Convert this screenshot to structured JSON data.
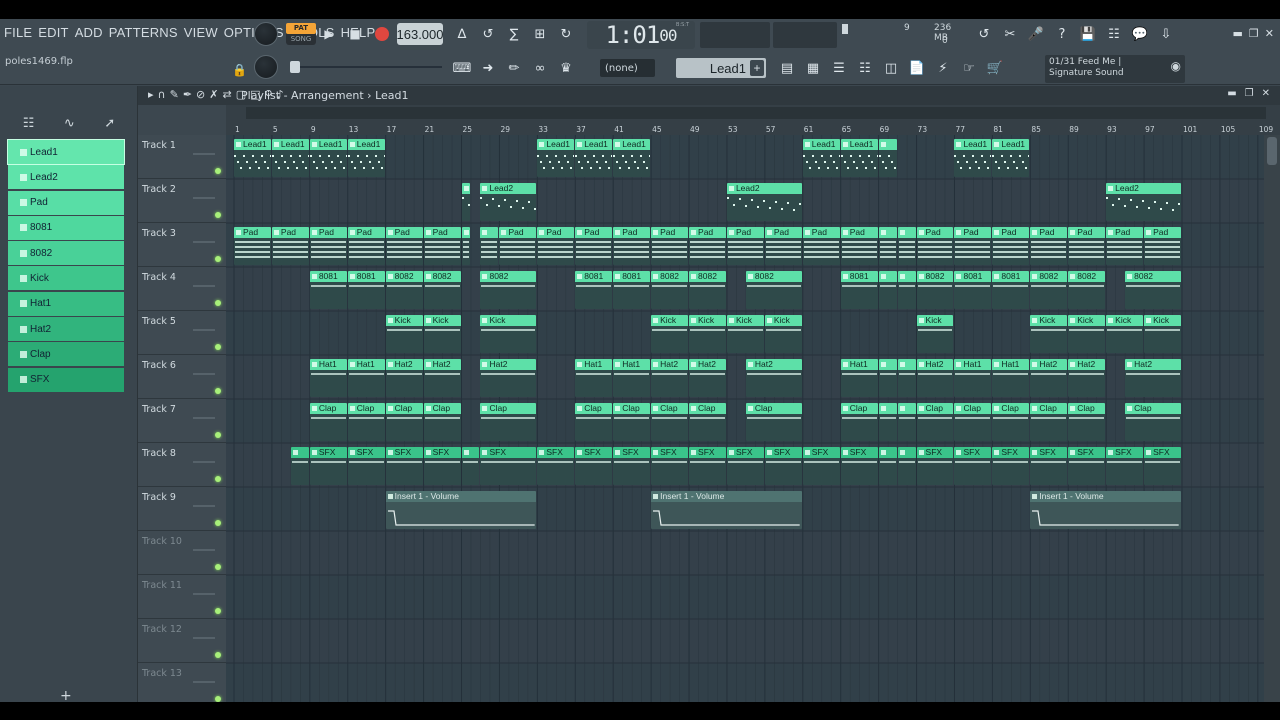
{
  "menu": [
    "FILE",
    "EDIT",
    "ADD",
    "PATTERNS",
    "VIEW",
    "OPTIONS",
    "TOOLS",
    "HELP"
  ],
  "file_name": "poles1469.flp",
  "transport": {
    "pat": "PAT",
    "song": "SONG",
    "tempo": "163.000",
    "time_main": "1:01",
    "time_sub": "00",
    "bst": "B:S:T"
  },
  "meter": {
    "cpu": "9",
    "mem": "236 MB",
    "poly": "0"
  },
  "pattern_selector": {
    "none": "(none)",
    "current": "Lead1",
    "plus": "+"
  },
  "song_info": {
    "line1": "01/31  Feed Me |",
    "line2": "Signature Sound"
  },
  "playlist": {
    "title": "Playlist - Arrangement",
    "breadcrumb_sep": "›",
    "pattern": "Lead1"
  },
  "picker": {
    "items": [
      "Lead1",
      "Lead2",
      "Pad",
      "8081",
      "8082",
      "Kick",
      "Hat1",
      "Hat2",
      "Clap",
      "SFX"
    ],
    "plus": "+"
  },
  "tracks": [
    "Track 1",
    "Track 2",
    "Track 3",
    "Track 4",
    "Track 5",
    "Track 6",
    "Track 7",
    "Track 8",
    "Track 9",
    "Track 10",
    "Track 11",
    "Track 12",
    "Track 13"
  ],
  "ruler": [
    "1",
    "5",
    "9",
    "13",
    "17",
    "21",
    "25",
    "29",
    "33",
    "37",
    "41",
    "45",
    "49",
    "53",
    "57",
    "61",
    "65",
    "69",
    "73",
    "77",
    "81",
    "85",
    "89",
    "93",
    "97",
    "101",
    "105",
    "109"
  ],
  "colors": {
    "clip": "#5de0a8",
    "clip_dark": "#3ac48a",
    "grid": "#2f3b42",
    "auto": "#4a6a66"
  },
  "clips": [
    {
      "t": 0,
      "bar": 1,
      "len": 4,
      "name": "Lead1"
    },
    {
      "t": 0,
      "bar": 5,
      "len": 4,
      "name": "Lead1"
    },
    {
      "t": 0,
      "bar": 9,
      "len": 4,
      "name": "Lead1"
    },
    {
      "t": 0,
      "bar": 13,
      "len": 4,
      "name": "Lead1"
    },
    {
      "t": 0,
      "bar": 33,
      "len": 4,
      "name": "Lead1"
    },
    {
      "t": 0,
      "bar": 37,
      "len": 4,
      "name": "Lead1"
    },
    {
      "t": 0,
      "bar": 41,
      "len": 4,
      "name": "Lead1"
    },
    {
      "t": 0,
      "bar": 61,
      "len": 4,
      "name": "Lead1"
    },
    {
      "t": 0,
      "bar": 65,
      "len": 4,
      "name": "Lead1"
    },
    {
      "t": 0,
      "bar": 69,
      "len": 2,
      "name": ""
    },
    {
      "t": 0,
      "bar": 77,
      "len": 4,
      "name": "Lead1"
    },
    {
      "t": 0,
      "bar": 81,
      "len": 4,
      "name": "Lead1"
    },
    {
      "t": 1,
      "bar": 25,
      "len": 1,
      "name": ""
    },
    {
      "t": 1,
      "bar": 27,
      "len": 6,
      "name": "Lead2"
    },
    {
      "t": 1,
      "bar": 53,
      "len": 8,
      "name": "Lead2"
    },
    {
      "t": 1,
      "bar": 93,
      "len": 8,
      "name": "Lead2"
    },
    {
      "t": 2,
      "bar": 1,
      "len": 4,
      "name": "Pad"
    },
    {
      "t": 2,
      "bar": 5,
      "len": 4,
      "name": "Pad"
    },
    {
      "t": 2,
      "bar": 9,
      "len": 4,
      "name": "Pad"
    },
    {
      "t": 2,
      "bar": 13,
      "len": 4,
      "name": "Pad"
    },
    {
      "t": 2,
      "bar": 17,
      "len": 4,
      "name": "Pad"
    },
    {
      "t": 2,
      "bar": 21,
      "len": 4,
      "name": "Pad"
    },
    {
      "t": 2,
      "bar": 25,
      "len": 1,
      "name": ""
    },
    {
      "t": 2,
      "bar": 27,
      "len": 2,
      "name": ""
    },
    {
      "t": 2,
      "bar": 29,
      "len": 4,
      "name": "Pad"
    },
    {
      "t": 2,
      "bar": 33,
      "len": 4,
      "name": "Pad"
    },
    {
      "t": 2,
      "bar": 37,
      "len": 4,
      "name": "Pad"
    },
    {
      "t": 2,
      "bar": 41,
      "len": 4,
      "name": "Pad"
    },
    {
      "t": 2,
      "bar": 45,
      "len": 4,
      "name": "Pad"
    },
    {
      "t": 2,
      "bar": 49,
      "len": 4,
      "name": "Pad"
    },
    {
      "t": 2,
      "bar": 53,
      "len": 4,
      "name": "Pad"
    },
    {
      "t": 2,
      "bar": 57,
      "len": 4,
      "name": "Pad"
    },
    {
      "t": 2,
      "bar": 61,
      "len": 4,
      "name": "Pad"
    },
    {
      "t": 2,
      "bar": 65,
      "len": 4,
      "name": "Pad"
    },
    {
      "t": 2,
      "bar": 69,
      "len": 2,
      "name": ""
    },
    {
      "t": 2,
      "bar": 71,
      "len": 2,
      "name": ""
    },
    {
      "t": 2,
      "bar": 73,
      "len": 4,
      "name": "Pad"
    },
    {
      "t": 2,
      "bar": 77,
      "len": 4,
      "name": "Pad"
    },
    {
      "t": 2,
      "bar": 81,
      "len": 4,
      "name": "Pad"
    },
    {
      "t": 2,
      "bar": 85,
      "len": 4,
      "name": "Pad"
    },
    {
      "t": 2,
      "bar": 89,
      "len": 4,
      "name": "Pad"
    },
    {
      "t": 2,
      "bar": 93,
      "len": 4,
      "name": "Pad"
    },
    {
      "t": 2,
      "bar": 97,
      "len": 4,
      "name": "Pad"
    },
    {
      "t": 3,
      "bar": 9,
      "len": 4,
      "name": "8081"
    },
    {
      "t": 3,
      "bar": 13,
      "len": 4,
      "name": "8081"
    },
    {
      "t": 3,
      "bar": 17,
      "len": 4,
      "name": "8082"
    },
    {
      "t": 3,
      "bar": 21,
      "len": 4,
      "name": "8082"
    },
    {
      "t": 3,
      "bar": 27,
      "len": 6,
      "name": "8082"
    },
    {
      "t": 3,
      "bar": 37,
      "len": 4,
      "name": "8081"
    },
    {
      "t": 3,
      "bar": 41,
      "len": 4,
      "name": "8081"
    },
    {
      "t": 3,
      "bar": 45,
      "len": 4,
      "name": "8082"
    },
    {
      "t": 3,
      "bar": 49,
      "len": 4,
      "name": "8082"
    },
    {
      "t": 3,
      "bar": 55,
      "len": 6,
      "name": "8082"
    },
    {
      "t": 3,
      "bar": 65,
      "len": 4,
      "name": "8081"
    },
    {
      "t": 3,
      "bar": 69,
      "len": 2,
      "name": ""
    },
    {
      "t": 3,
      "bar": 71,
      "len": 2,
      "name": ""
    },
    {
      "t": 3,
      "bar": 73,
      "len": 4,
      "name": "8082"
    },
    {
      "t": 3,
      "bar": 77,
      "len": 4,
      "name": "8081"
    },
    {
      "t": 3,
      "bar": 81,
      "len": 4,
      "name": "8081"
    },
    {
      "t": 3,
      "bar": 85,
      "len": 4,
      "name": "8082"
    },
    {
      "t": 3,
      "bar": 89,
      "len": 4,
      "name": "8082"
    },
    {
      "t": 3,
      "bar": 95,
      "len": 6,
      "name": "8082"
    },
    {
      "t": 4,
      "bar": 17,
      "len": 4,
      "name": "Kick"
    },
    {
      "t": 4,
      "bar": 21,
      "len": 4,
      "name": "Kick"
    },
    {
      "t": 4,
      "bar": 27,
      "len": 6,
      "name": "Kick"
    },
    {
      "t": 4,
      "bar": 45,
      "len": 4,
      "name": "Kick"
    },
    {
      "t": 4,
      "bar": 49,
      "len": 4,
      "name": "Kick"
    },
    {
      "t": 4,
      "bar": 53,
      "len": 4,
      "name": "Kick"
    },
    {
      "t": 4,
      "bar": 57,
      "len": 4,
      "name": "Kick"
    },
    {
      "t": 4,
      "bar": 73,
      "len": 4,
      "name": "Kick"
    },
    {
      "t": 4,
      "bar": 85,
      "len": 4,
      "name": "Kick"
    },
    {
      "t": 4,
      "bar": 89,
      "len": 4,
      "name": "Kick"
    },
    {
      "t": 4,
      "bar": 93,
      "len": 4,
      "name": "Kick"
    },
    {
      "t": 4,
      "bar": 97,
      "len": 4,
      "name": "Kick"
    },
    {
      "t": 5,
      "bar": 9,
      "len": 4,
      "name": "Hat1"
    },
    {
      "t": 5,
      "bar": 13,
      "len": 4,
      "name": "Hat1"
    },
    {
      "t": 5,
      "bar": 17,
      "len": 4,
      "name": "Hat2"
    },
    {
      "t": 5,
      "bar": 21,
      "len": 4,
      "name": "Hat2"
    },
    {
      "t": 5,
      "bar": 27,
      "len": 6,
      "name": "Hat2"
    },
    {
      "t": 5,
      "bar": 37,
      "len": 4,
      "name": "Hat1"
    },
    {
      "t": 5,
      "bar": 41,
      "len": 4,
      "name": "Hat1"
    },
    {
      "t": 5,
      "bar": 45,
      "len": 4,
      "name": "Hat2"
    },
    {
      "t": 5,
      "bar": 49,
      "len": 4,
      "name": "Hat2"
    },
    {
      "t": 5,
      "bar": 55,
      "len": 6,
      "name": "Hat2"
    },
    {
      "t": 5,
      "bar": 65,
      "len": 4,
      "name": "Hat1"
    },
    {
      "t": 5,
      "bar": 69,
      "len": 2,
      "name": ""
    },
    {
      "t": 5,
      "bar": 71,
      "len": 2,
      "name": ""
    },
    {
      "t": 5,
      "bar": 73,
      "len": 4,
      "name": "Hat2"
    },
    {
      "t": 5,
      "bar": 77,
      "len": 4,
      "name": "Hat1"
    },
    {
      "t": 5,
      "bar": 81,
      "len": 4,
      "name": "Hat1"
    },
    {
      "t": 5,
      "bar": 85,
      "len": 4,
      "name": "Hat2"
    },
    {
      "t": 5,
      "bar": 89,
      "len": 4,
      "name": "Hat2"
    },
    {
      "t": 5,
      "bar": 95,
      "len": 6,
      "name": "Hat2"
    },
    {
      "t": 6,
      "bar": 9,
      "len": 4,
      "name": "Clap"
    },
    {
      "t": 6,
      "bar": 13,
      "len": 4,
      "name": "Clap"
    },
    {
      "t": 6,
      "bar": 17,
      "len": 4,
      "name": "Clap"
    },
    {
      "t": 6,
      "bar": 21,
      "len": 4,
      "name": "Clap"
    },
    {
      "t": 6,
      "bar": 27,
      "len": 6,
      "name": "Clap"
    },
    {
      "t": 6,
      "bar": 37,
      "len": 4,
      "name": "Clap"
    },
    {
      "t": 6,
      "bar": 41,
      "len": 4,
      "name": "Clap"
    },
    {
      "t": 6,
      "bar": 45,
      "len": 4,
      "name": "Clap"
    },
    {
      "t": 6,
      "bar": 49,
      "len": 4,
      "name": "Clap"
    },
    {
      "t": 6,
      "bar": 55,
      "len": 6,
      "name": "Clap"
    },
    {
      "t": 6,
      "bar": 65,
      "len": 4,
      "name": "Clap"
    },
    {
      "t": 6,
      "bar": 69,
      "len": 2,
      "name": ""
    },
    {
      "t": 6,
      "bar": 71,
      "len": 2,
      "name": ""
    },
    {
      "t": 6,
      "bar": 73,
      "len": 4,
      "name": "Clap"
    },
    {
      "t": 6,
      "bar": 77,
      "len": 4,
      "name": "Clap"
    },
    {
      "t": 6,
      "bar": 81,
      "len": 4,
      "name": "Clap"
    },
    {
      "t": 6,
      "bar": 85,
      "len": 4,
      "name": "Clap"
    },
    {
      "t": 6,
      "bar": 89,
      "len": 4,
      "name": "Clap"
    },
    {
      "t": 6,
      "bar": 95,
      "len": 6,
      "name": "Clap"
    },
    {
      "t": 7,
      "bar": 7,
      "len": 2,
      "name": ""
    },
    {
      "t": 7,
      "bar": 9,
      "len": 4,
      "name": "SFX"
    },
    {
      "t": 7,
      "bar": 13,
      "len": 4,
      "name": "SFX"
    },
    {
      "t": 7,
      "bar": 17,
      "len": 4,
      "name": "SFX"
    },
    {
      "t": 7,
      "bar": 21,
      "len": 4,
      "name": "SFX"
    },
    {
      "t": 7,
      "bar": 25,
      "len": 2,
      "name": ""
    },
    {
      "t": 7,
      "bar": 27,
      "len": 6,
      "name": "SFX"
    },
    {
      "t": 7,
      "bar": 33,
      "len": 4,
      "name": "SFX"
    },
    {
      "t": 7,
      "bar": 37,
      "len": 4,
      "name": "SFX"
    },
    {
      "t": 7,
      "bar": 41,
      "len": 4,
      "name": "SFX"
    },
    {
      "t": 7,
      "bar": 45,
      "len": 4,
      "name": "SFX"
    },
    {
      "t": 7,
      "bar": 49,
      "len": 4,
      "name": "SFX"
    },
    {
      "t": 7,
      "bar": 53,
      "len": 4,
      "name": "SFX"
    },
    {
      "t": 7,
      "bar": 57,
      "len": 4,
      "name": "SFX"
    },
    {
      "t": 7,
      "bar": 61,
      "len": 4,
      "name": "SFX"
    },
    {
      "t": 7,
      "bar": 65,
      "len": 4,
      "name": "SFX"
    },
    {
      "t": 7,
      "bar": 69,
      "len": 2,
      "name": ""
    },
    {
      "t": 7,
      "bar": 71,
      "len": 2,
      "name": ""
    },
    {
      "t": 7,
      "bar": 73,
      "len": 4,
      "name": "SFX"
    },
    {
      "t": 7,
      "bar": 77,
      "len": 4,
      "name": "SFX"
    },
    {
      "t": 7,
      "bar": 81,
      "len": 4,
      "name": "SFX"
    },
    {
      "t": 7,
      "bar": 85,
      "len": 4,
      "name": "SFX"
    },
    {
      "t": 7,
      "bar": 89,
      "len": 4,
      "name": "SFX"
    },
    {
      "t": 7,
      "bar": 93,
      "len": 4,
      "name": "SFX"
    },
    {
      "t": 7,
      "bar": 97,
      "len": 4,
      "name": "SFX"
    },
    {
      "t": 8,
      "bar": 17,
      "len": 16,
      "name": "Insert 1 - Volume",
      "auto": true
    },
    {
      "t": 8,
      "bar": 45,
      "len": 16,
      "name": "Insert 1 - Volume",
      "auto": true
    },
    {
      "t": 8,
      "bar": 85,
      "len": 16,
      "name": "Insert 1 - Volume",
      "auto": true
    }
  ]
}
